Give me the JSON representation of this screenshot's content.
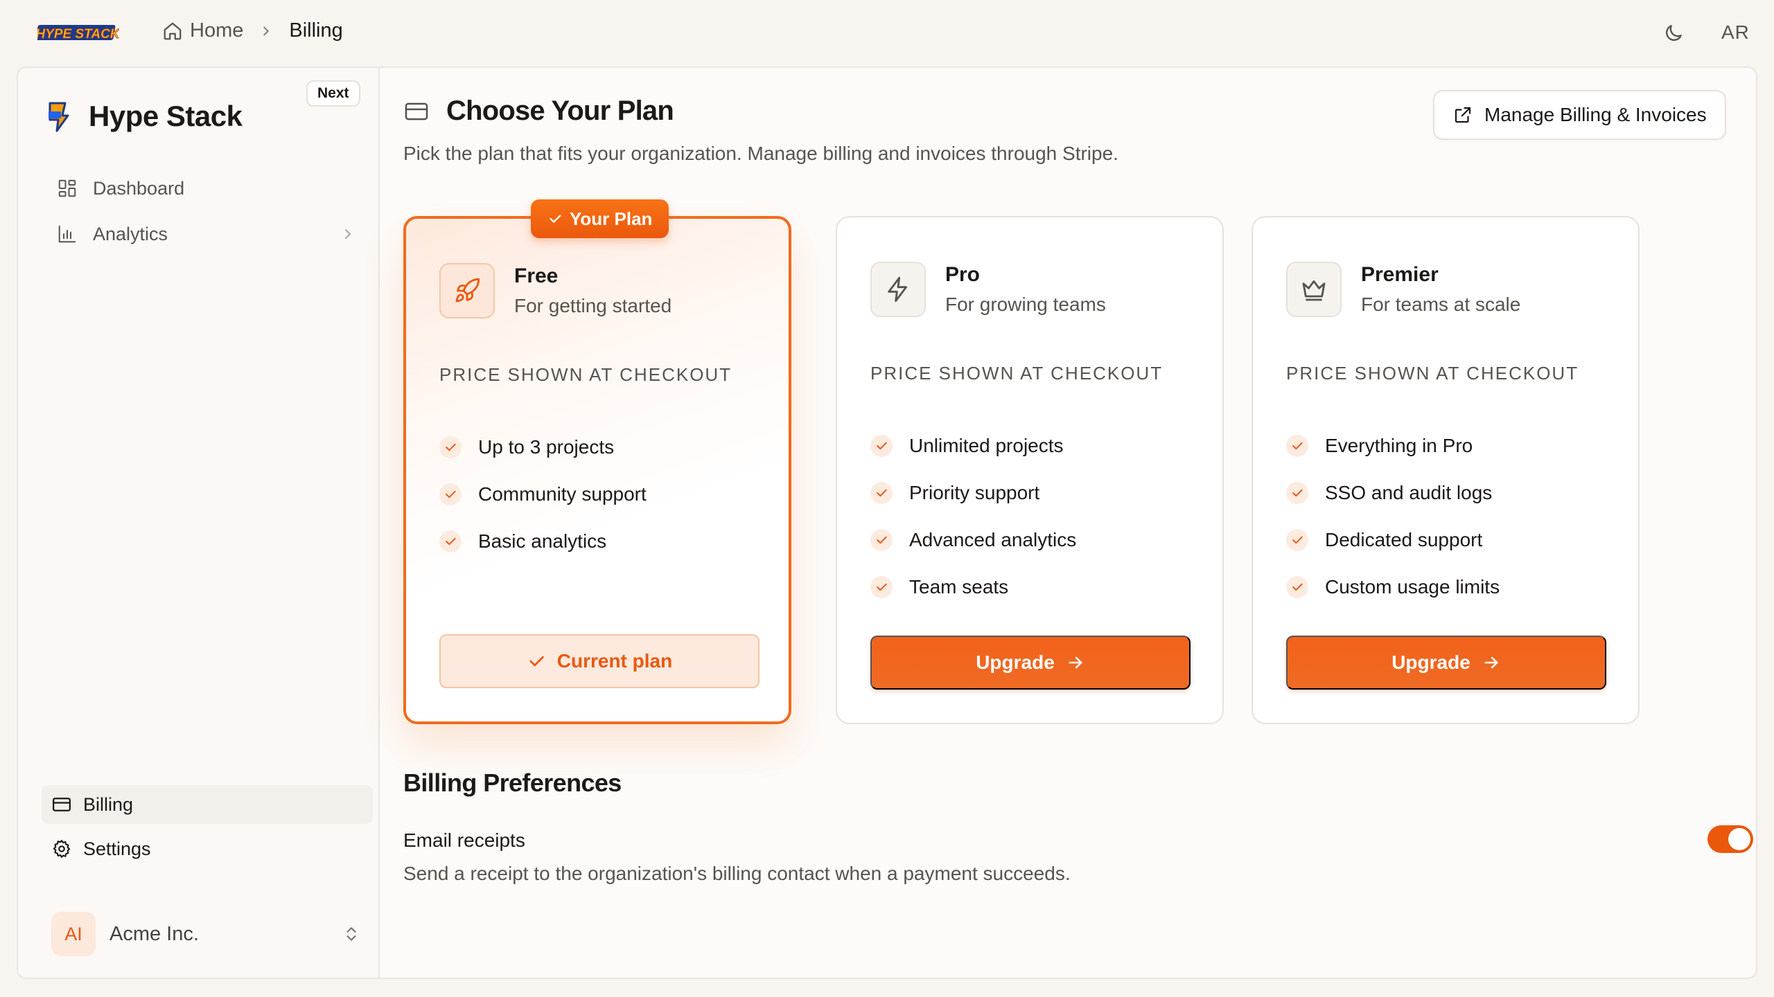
{
  "topbar": {
    "logo_text": "HYPE STACK",
    "breadcrumb": {
      "home": "Home",
      "current": "Billing"
    },
    "user_initials": "AR",
    "theme_icon": "moon-icon"
  },
  "sidebar": {
    "brand": "Hype Stack",
    "badge": "Next",
    "nav_top": [
      {
        "label": "Dashboard",
        "icon": "dashboard-icon"
      },
      {
        "label": "Analytics",
        "icon": "bar-chart-icon"
      }
    ],
    "nav_bottom": [
      {
        "label": "Billing",
        "icon": "credit-card-icon",
        "active": true
      },
      {
        "label": "Settings",
        "icon": "gear-icon"
      }
    ],
    "org": {
      "initials": "AI",
      "name": "Acme Inc."
    }
  },
  "main": {
    "title": "Choose Your Plan",
    "subtitle": "Pick the plan that fits your organization. Manage billing and invoices through Stripe.",
    "manage_label": "Manage Billing & Invoices",
    "plans": [
      {
        "name": "Free",
        "tagline": "For getting started",
        "icon": "rocket-icon",
        "badge": "Your Plan",
        "price": "PRICE SHOWN AT CHECKOUT",
        "features": [
          "Up to 3 projects",
          "Community support",
          "Basic analytics"
        ],
        "button": "Current plan",
        "current": true
      },
      {
        "name": "Pro",
        "tagline": "For growing teams",
        "icon": "lightning-icon",
        "price": "PRICE SHOWN AT CHECKOUT",
        "features": [
          "Unlimited projects",
          "Priority support",
          "Advanced analytics",
          "Team seats"
        ],
        "button": "Upgrade"
      },
      {
        "name": "Premier",
        "tagline": "For teams at scale",
        "icon": "crown-icon",
        "price": "PRICE SHOWN AT CHECKOUT",
        "features": [
          "Everything in Pro",
          "SSO and audit logs",
          "Dedicated support",
          "Custom usage limits"
        ],
        "button": "Upgrade"
      }
    ],
    "preferences": {
      "title": "Billing Preferences",
      "email_receipts": {
        "label": "Email receipts",
        "description": "Send a receipt to the organization's billing contact when a payment succeeds.",
        "enabled": true
      }
    }
  },
  "colors": {
    "accent": "#ea580c",
    "background": "#f8f5f1"
  }
}
